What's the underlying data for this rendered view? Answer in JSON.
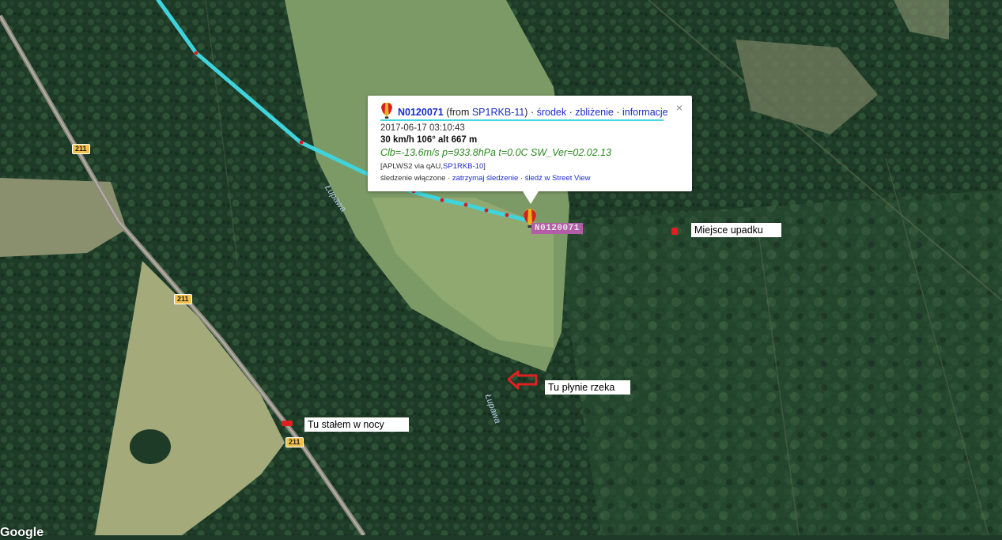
{
  "popup": {
    "callsign": "N0120071",
    "from_prefix": "(from ",
    "from_station": "SP1RKB-11",
    "from_suffix": ")",
    "links": [
      "środek",
      "zbliżenie",
      "informacje"
    ],
    "close": "×",
    "time": "2017-06-17 03:10:43",
    "speed": "30 km/h 106° alt 667 m",
    "comment": "Clb=-13.6m/s p=933.8hPa t=0.0C SW_Ver=02.02.13",
    "path_prefix": "[APLWS2 via qAU,",
    "path_station": "SP1RKB-10",
    "path_suffix": "]",
    "tracking_status": "śledzenie włączone",
    "tracking_links": [
      "zatrzymaj śledzenie",
      "śledź w Street View"
    ]
  },
  "station_label": "N0120071",
  "annotations": {
    "crash_site": "Miejsce upadku",
    "river": "Tu płynie rzeka",
    "night_stop": "Tu stałem w nocy"
  },
  "road_labels": [
    "211",
    "211",
    "211"
  ],
  "river_labels": [
    "Łupawa",
    "Łupawa"
  ],
  "attribution": "Google",
  "colors": {
    "track": "#3fd4dc",
    "marker_red": "#e02020",
    "station_label_bg": "#b35da8"
  }
}
